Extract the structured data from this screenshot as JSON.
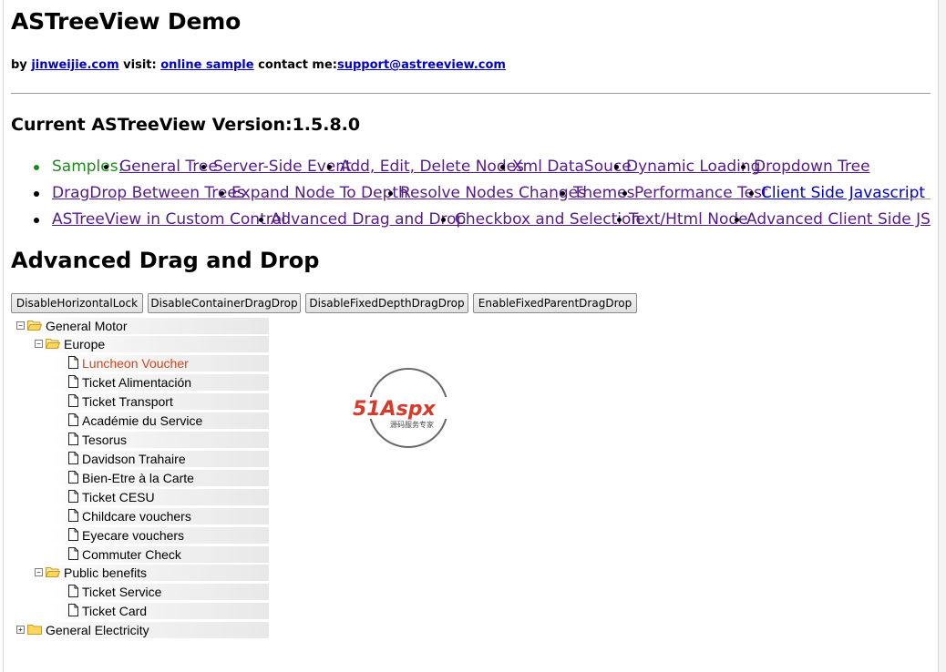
{
  "header": {
    "title": "ASTreeView Demo",
    "by_label": "by",
    "author_link": "jinweijie.com",
    "visit_label": "visit:",
    "sample_link": "online sample",
    "contact_label": "contact me:",
    "email_link": "support@astreeview.com"
  },
  "version_heading": "Current ASTreeView Version:1.5.8.0",
  "samples": {
    "lead": "Samples:",
    "rows": [
      [
        "General Tree",
        "Server-Side Event",
        "Add, Edit, Delete Nodes",
        "Xml DataSouce",
        "Dynamic Loading",
        "Dropdown Tree"
      ],
      [
        "DragDrop Between Trees",
        "Expand Node To Depth",
        "Resolve Nodes Changes",
        "Themes",
        "Performance Test",
        "Client Side Javascript"
      ],
      [
        "ASTreeView in Custom Control",
        "Advanced Drag and Drop",
        "Checkbox and Selection",
        "Text/Html Node",
        "Advanced Client Side JS"
      ]
    ]
  },
  "section_heading": "Advanced Drag and Drop",
  "buttons": [
    "DisableHorizontalLock",
    "DisableContainerDragDrop",
    "DisableFixedDepthDragDrop",
    "EnableFixedParentDragDrop"
  ],
  "tree": {
    "root1": "General Motor",
    "europe": "Europe",
    "europe_items": [
      "Luncheon Voucher",
      "Ticket Alimentación",
      "Ticket Transport",
      "Académie du Service",
      "Tesorus",
      "Davidson Trahaire",
      "Bien-Etre à la Carte",
      "Ticket CESU",
      "Childcare vouchers",
      "Eyecare vouchers",
      "Commuter Check"
    ],
    "public": "Public benefits",
    "public_items": [
      "Ticket Service",
      "Ticket Card"
    ],
    "root2": "General Electricity",
    "expanded_glyph": "−",
    "collapsed_glyph": "+"
  },
  "watermark": {
    "brand": "51Aspx",
    "tagline": "源码服务专家"
  },
  "colors": {
    "link": "#551a8b",
    "lead_green": "#1a8a1a",
    "highlight": "#d8431a"
  }
}
